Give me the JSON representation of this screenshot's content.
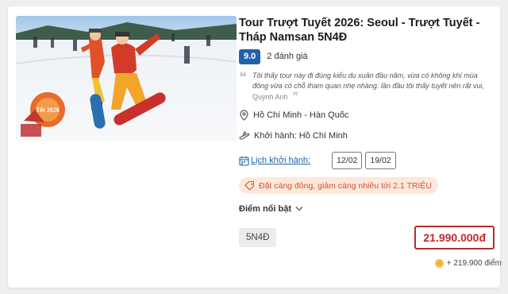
{
  "tour": {
    "title": "Tour Trượt Tuyết 2026: Seoul - Trượt Tuyết - Tháp Namsan 5N4Đ",
    "rating_score": "9.0",
    "review_count": "2 đánh giá",
    "review_quote": "Tôi thấy tour này đi đúng kiểu du xuân đầu năm, vừa có không khí mùa đông vừa có chỗ tham quan nhẹ nhàng. lần đầu tôi thấy tuyết nên rất vui, chơi...",
    "review_author": "Quỳnh Anh",
    "location": "Hồ Chí Minh - Hàn Quốc",
    "departure": "Khởi hành: Hồ Chí Minh",
    "schedule_label": "Lịch khởi hành:",
    "dates": [
      "12/02",
      "19/02"
    ],
    "promo": "Đặt càng đông, giảm càng nhiều tới 2.1 TRIỆU",
    "highlight_label": "Điểm nổi bật",
    "duration": "5N4Đ",
    "price": "21.990.000đ",
    "points": "+ 219.900 điểm",
    "badge_text": "Tết 2026"
  },
  "colors": {
    "brand_blue": "#1f63a8",
    "price_red": "#c62828",
    "promo_bg": "#fde8dc",
    "promo_text": "#d2522a"
  },
  "icons": {
    "location": "map-pin-icon",
    "departure": "plane-icon",
    "calendar": "calendar-icon",
    "tag": "tag-icon",
    "chevron": "chevron-down-icon",
    "coin": "coin-icon"
  }
}
